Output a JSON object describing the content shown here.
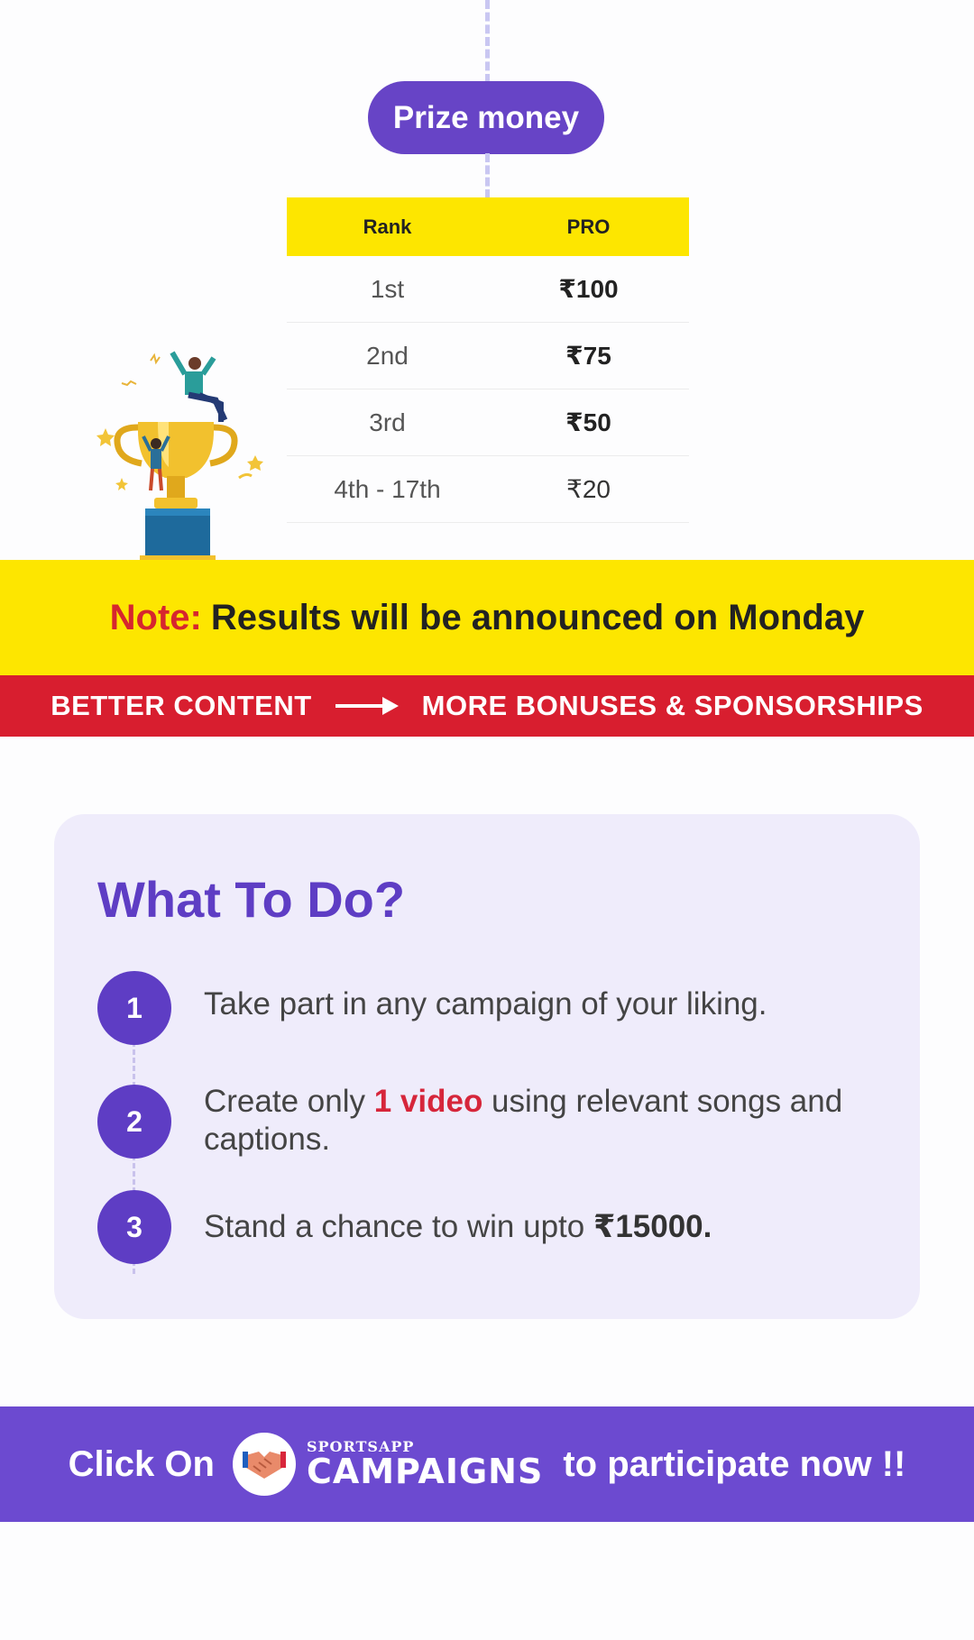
{
  "prize_section": {
    "pill_label": "Prize money",
    "headers": {
      "rank": "Rank",
      "tier": "PRO"
    },
    "rows": [
      {
        "rank": "1st",
        "amount": "₹100"
      },
      {
        "rank": "2nd",
        "amount": "₹75"
      },
      {
        "rank": "3rd",
        "amount": "₹50"
      },
      {
        "rank": "4th - 17th",
        "amount": "₹20"
      }
    ]
  },
  "note": {
    "label": "Note:",
    "text": "Results will be announced on Monday"
  },
  "strip": {
    "left": "BETTER CONTENT",
    "right": "MORE BONUSES & SPONSORSHIPS"
  },
  "what_to_do": {
    "title": "What To Do?",
    "steps": [
      {
        "num": "1",
        "text": "Take part in any campaign of your liking."
      },
      {
        "num": "2",
        "pre": "Create only ",
        "highlight": "1 video",
        "post": " using relevant songs and captions."
      },
      {
        "num": "3",
        "pre": "Stand a chance to win upto ",
        "strong": "₹15000."
      }
    ]
  },
  "cta": {
    "pre": "Click On",
    "brand_small": "SPORTSAPP",
    "brand_big": "CAMPAIGNS",
    "post": "to participate now !!"
  },
  "colors": {
    "purple": "#6744c6",
    "yellow": "#fde600",
    "red": "#d81e2f",
    "card_bg": "#efecfb"
  }
}
